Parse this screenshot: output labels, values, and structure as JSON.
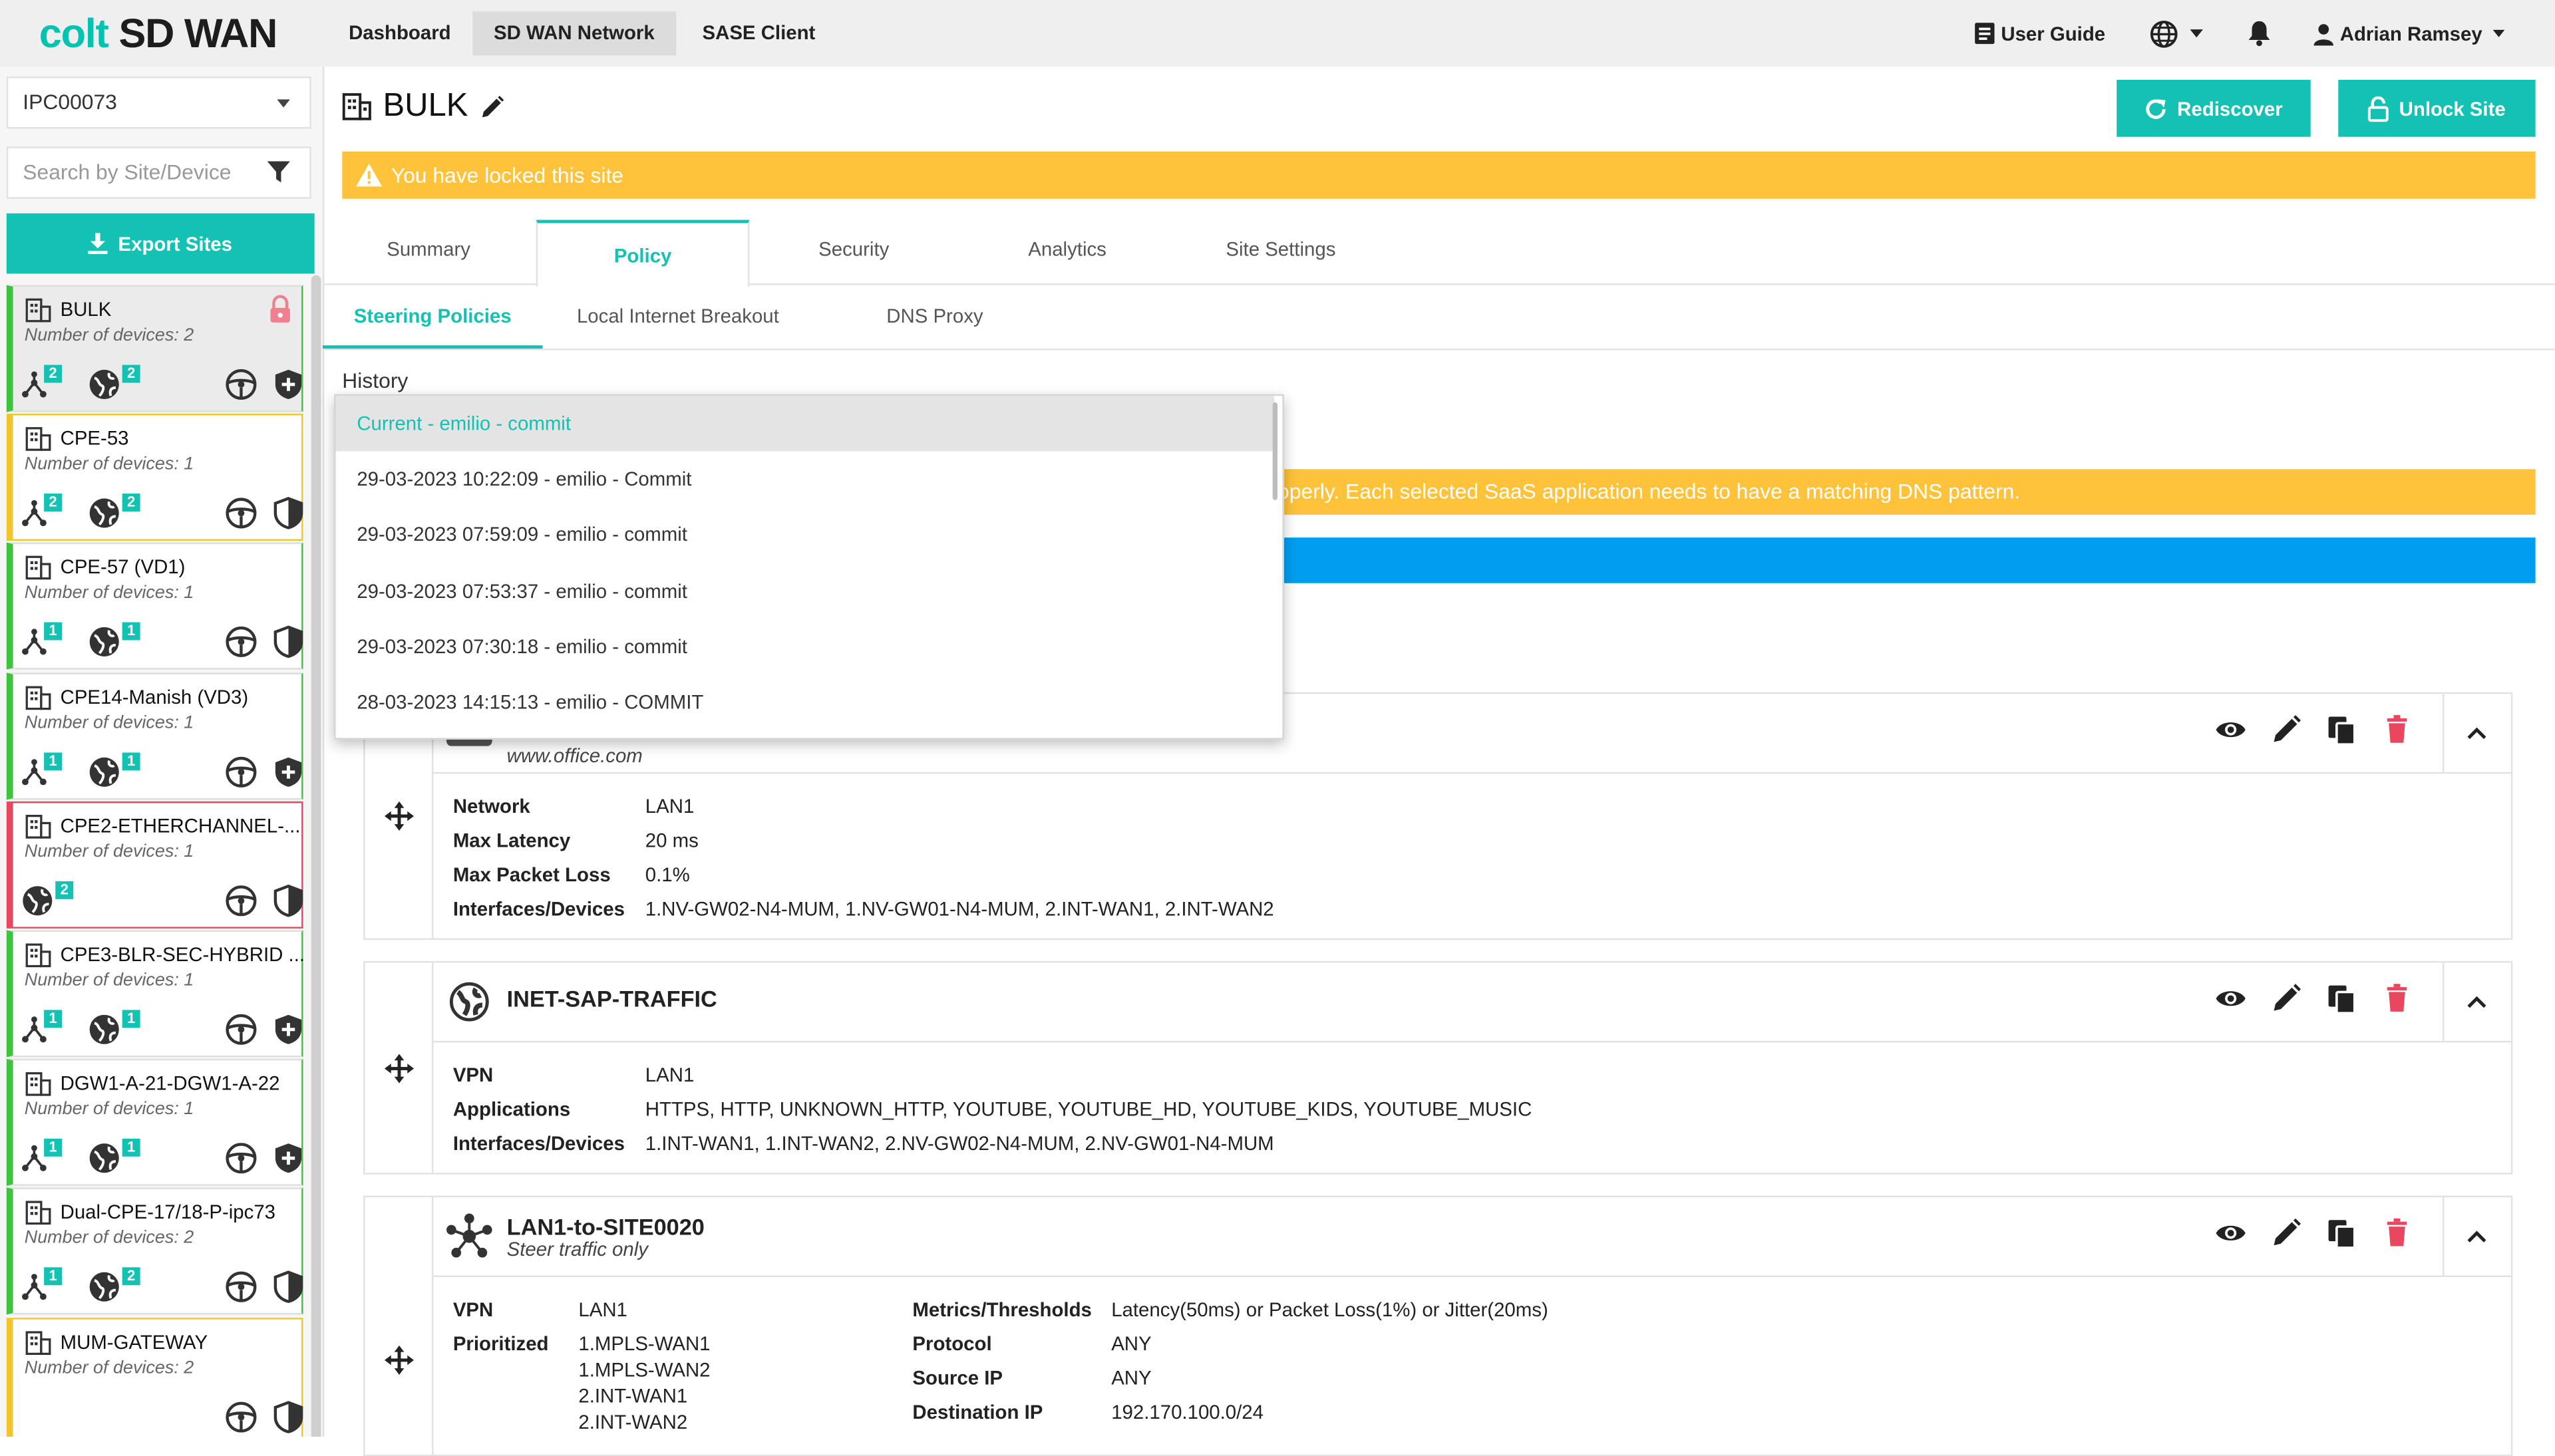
{
  "app": {
    "logo_brand": "colt",
    "logo_product": "SD WAN"
  },
  "nav": {
    "items": [
      "Dashboard",
      "SD WAN Network",
      "SASE Client"
    ],
    "active": "SD WAN Network"
  },
  "topbar": {
    "user_guide": "User Guide",
    "user_name": "Adrian Ramsey"
  },
  "sidebar": {
    "selected_customer": "IPC00073",
    "search_placeholder": "Search by Site/Device",
    "export_label": "Export Sites",
    "sites": [
      {
        "name": "BULK",
        "count": "Number of devices: 2",
        "status": "green",
        "badge1": "2",
        "badge2": "2",
        "locked": true,
        "selected": true
      },
      {
        "name": "CPE-53",
        "count": "Number of devices: 1",
        "status": "yellow",
        "badge1": "2",
        "badge2": "2"
      },
      {
        "name": "CPE-57 (VD1)",
        "count": "Number of devices: 1",
        "status": "green",
        "badge1": "1",
        "badge2": "1"
      },
      {
        "name": "CPE14-Manish (VD3)",
        "count": "Number of devices: 1",
        "status": "green",
        "badge1": "1",
        "badge2": "1"
      },
      {
        "name": "CPE2-ETHERCHANNEL-...",
        "count": "Number of devices: 1",
        "status": "red",
        "badge1": "",
        "badge2": "2"
      },
      {
        "name": "CPE3-BLR-SEC-HYBRID ...",
        "count": "Number of devices: 1",
        "status": "green",
        "badge1": "1",
        "badge2": "1"
      },
      {
        "name": "DGW1-A-21-DGW1-A-22",
        "count": "Number of devices: 1",
        "status": "green",
        "badge1": "1",
        "badge2": "1"
      },
      {
        "name": "Dual-CPE-17/18-P-ipc73",
        "count": "Number of devices: 2",
        "status": "green",
        "badge1": "1",
        "badge2": "2"
      },
      {
        "name": "MUM-GATEWAY",
        "count": "Number of devices: 2",
        "status": "yellow",
        "badge1": "",
        "badge2": ""
      }
    ]
  },
  "main": {
    "site_title": "BULK",
    "rediscover_label": "Rediscover",
    "unlock_label": "Unlock Site",
    "lock_banner": "You have locked this site",
    "tabs": [
      "Summary",
      "Policy",
      "Security",
      "Analytics",
      "Site Settings"
    ],
    "active_tab": "Policy",
    "subtabs": [
      "Steering Policies",
      "Local Internet Breakout",
      "DNS Proxy"
    ],
    "active_subtab": "Steering Policies",
    "history_label": "History",
    "warning_text": "operly. Each selected SaaS application needs to have a matching DNS pattern."
  },
  "history_dropdown": {
    "options": [
      "Current - emilio - commit",
      "29-03-2023 10:22:09 - emilio - Commit",
      "29-03-2023 07:59:09 - emilio - commit",
      "29-03-2023 07:53:37 - emilio - commit",
      "29-03-2023 07:30:18 - emilio - commit",
      "28-03-2023 14:15:13 - emilio - COMMIT"
    ],
    "selected": "Current - emilio - commit"
  },
  "policies": [
    {
      "subtitle": "www.office.com",
      "fields": [
        {
          "key": "Network",
          "value": "LAN1"
        },
        {
          "key": "Max Latency",
          "value": "20 ms"
        },
        {
          "key": "Max Packet Loss",
          "value": "0.1%"
        },
        {
          "key": "Interfaces/Devices",
          "value": "1.NV-GW02-N4-MUM, 1.NV-GW01-N4-MUM, 2.INT-WAN1, 2.INT-WAN2"
        }
      ]
    },
    {
      "name": "INET-SAP-TRAFFIC",
      "fields": [
        {
          "key": "VPN",
          "value": "LAN1"
        },
        {
          "key": "Applications",
          "value": "HTTPS, HTTP, UNKNOWN_HTTP, YOUTUBE, YOUTUBE_HD, YOUTUBE_KIDS, YOUTUBE_MUSIC"
        },
        {
          "key": "Interfaces/Devices",
          "value": "1.INT-WAN1, 1.INT-WAN2, 2.NV-GW02-N4-MUM, 2.NV-GW01-N4-MUM"
        }
      ]
    },
    {
      "name": "LAN1-to-SITE0020",
      "subtitle": "Steer traffic only",
      "left_fields": [
        {
          "key": "VPN",
          "value": "LAN1"
        },
        {
          "key": "Prioritized",
          "values": [
            "1.MPLS-WAN1",
            "1.MPLS-WAN2",
            "2.INT-WAN1",
            "2.INT-WAN2"
          ]
        }
      ],
      "right_fields": [
        {
          "key": "Metrics/Thresholds",
          "value": "Latency(50ms) or Packet Loss(1%) or Jitter(20ms)"
        },
        {
          "key": "Protocol",
          "value": "ANY"
        },
        {
          "key": "Source IP",
          "value": "ANY"
        },
        {
          "key": "Destination IP",
          "value": "192.170.100.0/24"
        }
      ]
    }
  ],
  "colors": {
    "teal": "#14c2b3",
    "warning": "#fec33a",
    "info": "#009ef0",
    "ok": "#3ec33e",
    "error": "#e8475f"
  }
}
